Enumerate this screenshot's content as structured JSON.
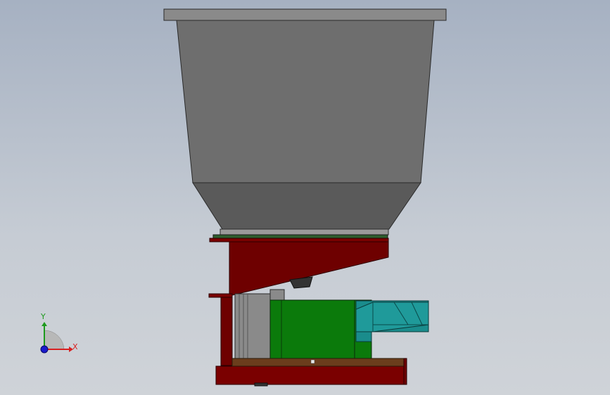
{
  "viewport": {
    "background_top": "#a6b1c2",
    "background_bottom": "#cfd3d8"
  },
  "model": {
    "hopper_color": "#6b6b6b",
    "frame_color": "#6e0000",
    "motor_color": "#0b7a0b",
    "chute_color": "#1a8c8c",
    "base_plate_color": "#6b3d1c"
  },
  "triad": {
    "x_label": "X",
    "y_label": "Y",
    "x_color": "#d82020",
    "y_color": "#1e9a1e",
    "z_color": "#1a1acc"
  }
}
